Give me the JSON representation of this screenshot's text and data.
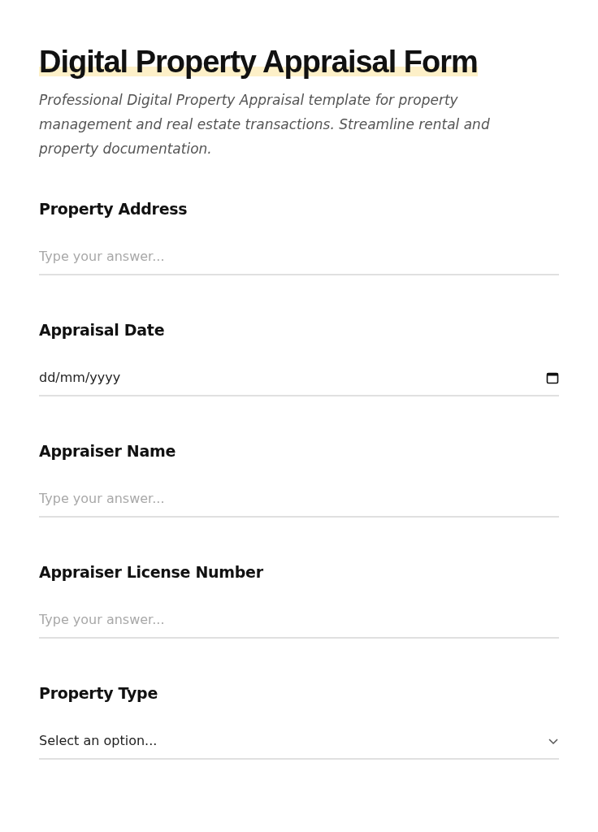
{
  "title": "Digital Property Appraisal Form",
  "description": "Professional Digital Property Appraisal template for property management and real estate transactions. Streamline rental and property documentation.",
  "fields": [
    {
      "kind": "text",
      "label": "Property Address",
      "placeholder": "Type your answer..."
    },
    {
      "kind": "date",
      "label": "Appraisal Date",
      "placeholder": "dd/mm/yyyy"
    },
    {
      "kind": "text",
      "label": "Appraiser Name",
      "placeholder": "Type your answer..."
    },
    {
      "kind": "text",
      "label": "Appraiser License Number",
      "placeholder": "Type your answer..."
    },
    {
      "kind": "select",
      "label": "Property Type",
      "placeholder": "Select an option..."
    }
  ]
}
